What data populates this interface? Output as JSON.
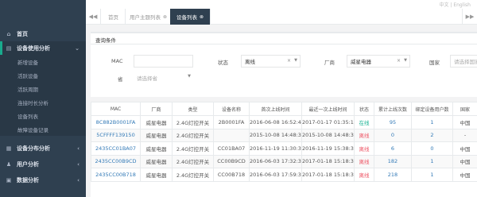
{
  "header": {
    "lang": "中文 | English"
  },
  "sidebar": {
    "items": [
      {
        "label": "首页",
        "icon": "home-icon"
      },
      {
        "label": "设备使用分析",
        "icon": "chart-icon"
      },
      {
        "label": "设备分布分析",
        "icon": "grid-icon"
      },
      {
        "label": "用户分析",
        "icon": "users-icon"
      },
      {
        "label": "数据分析",
        "icon": "data-icon"
      }
    ],
    "subitems": [
      "新增设备",
      "活跃设备",
      "活跃周期",
      "连接时长分析",
      "设备列表",
      "故障设备记录"
    ]
  },
  "tabs": {
    "items": [
      "首页",
      "用户主题列表",
      "设备列表"
    ],
    "nav_left": "◀◀",
    "nav_right": "▶▶"
  },
  "filter": {
    "title": "查询条件",
    "mac_label": "MAC",
    "mac_value": "",
    "status_label": "状态",
    "status_value": "离线",
    "vendor_label": "厂商",
    "vendor_value": "威星电器",
    "country_label": "国家",
    "country_placeholder": "请选择国家",
    "province_label": "省",
    "province_placeholder": "请选择省"
  },
  "table": {
    "headers": [
      "MAC",
      "厂商",
      "类型",
      "设备名称",
      "首次上线时间",
      "最近一次上线时间",
      "状态",
      "累计上线次数",
      "绑定设备用户数",
      "国家"
    ],
    "rows": [
      [
        "8C882B0001FA",
        "威星电器",
        "2.4G灯控开关",
        "2B0001FA",
        "2016-06-08 16:52:47",
        "2017-01-17 01:35:11",
        "在线",
        "95",
        "1",
        "中国"
      ],
      [
        "5CFFFF139150",
        "威星电器",
        "2.4G灯控开关",
        "",
        "2015-10-08 14:48:35",
        "2015-10-08 14:48:35",
        "离线",
        "0",
        "2",
        "-"
      ],
      [
        "2435CC01BA07",
        "威星电器",
        "2.4G灯控开关",
        "CC01BA07",
        "2016-11-19 11:30:39",
        "2016-11-19 15:38:37",
        "离线",
        "6",
        "0",
        "中国"
      ],
      [
        "2435CC00B9CD",
        "威星电器",
        "2.4G灯控开关",
        "CC00B9CD",
        "2016-06-03 17:32:38",
        "2017-01-18 15:18:30",
        "离线",
        "182",
        "1",
        "中国"
      ],
      [
        "2435CC00B718",
        "威星电器",
        "2.4G灯控开关",
        "CC00B718",
        "2016-06-03 17:59:30",
        "2017-01-18 15:18:30",
        "离线",
        "218",
        "1",
        "中国"
      ]
    ]
  },
  "colors": {
    "sidebar": "#2f4050",
    "accent": "#1ab394",
    "offline": "#ed5565",
    "link": "#337ab7"
  }
}
